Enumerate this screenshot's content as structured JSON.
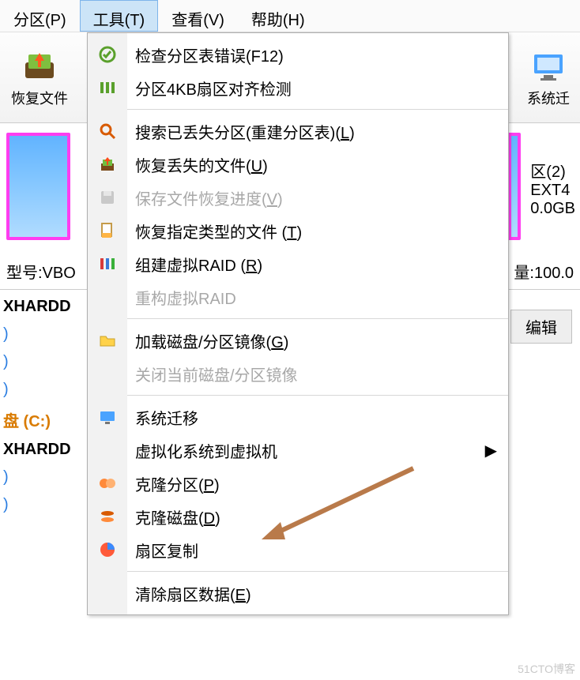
{
  "menubar": {
    "partition": "分区(P)",
    "tools": "工具(T)",
    "view": "查看(V)",
    "help": "帮助(H)"
  },
  "toolbar": {
    "recover_files": "恢复文件",
    "system_right": "系统迁"
  },
  "disk_right": {
    "name": "区(2)",
    "fs": "EXT4",
    "size": "0.0GB"
  },
  "meta": {
    "model": "型号:VBO",
    "capacity": "量:100.0"
  },
  "tab": {
    "edit": "编辑"
  },
  "tree": {
    "hd1": "XHARDD",
    "c": "盘 (C:)",
    "hd2": "XHARDD",
    "p": ")"
  },
  "menu": {
    "check_partition": "检查分区表错误(F12)",
    "align_4k": "分区4KB扇区对齐检测",
    "search_lost_pre": "搜索已丢失分区(重建分区表)(",
    "search_lost_u": "L",
    "recover_lost_pre": "恢复丢失的文件(",
    "recover_lost_u": "U",
    "save_progress_pre": "保存文件恢复进度(",
    "save_progress_u": "V",
    "recover_type_pre": "恢复指定类型的文件 (",
    "recover_type_u": "T",
    "build_raid_pre": "组建虚拟RAID (",
    "build_raid_u": "R",
    "rebuild_raid": "重构虚拟RAID",
    "load_image_pre": "加载磁盘/分区镜像(",
    "load_image_u": "G",
    "close_image": "关闭当前磁盘/分区镜像",
    "sys_migrate": "系统迁移",
    "virtualize": "虚拟化系统到虚拟机",
    "clone_part_pre": "克隆分区(",
    "clone_part_u": "P",
    "clone_disk_pre": "克隆磁盘(",
    "clone_disk_u": "D",
    "sector_copy": "扇区复制",
    "clear_sector_pre": "清除扇区数据(",
    "clear_sector_u": "E",
    "close_paren": ")"
  },
  "watermark": "51CTO博客"
}
